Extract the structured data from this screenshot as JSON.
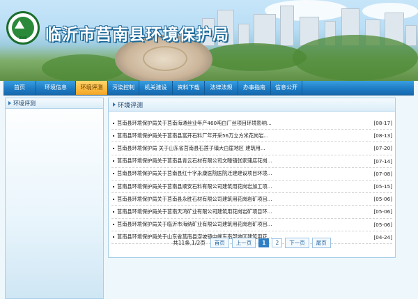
{
  "site": {
    "title": "临沂市莒南县环境保护局",
    "logo_text": "ZHB"
  },
  "nav": {
    "items": [
      {
        "label": "首页",
        "active": false
      },
      {
        "label": "环境信息",
        "active": false
      },
      {
        "label": "环境评测",
        "active": true
      },
      {
        "label": "污染控制",
        "active": false
      },
      {
        "label": "机关建设",
        "active": false
      },
      {
        "label": "资料下载",
        "active": false
      },
      {
        "label": "法律法规",
        "active": false
      },
      {
        "label": "办事指南",
        "active": false
      },
      {
        "label": "信息公开",
        "active": false
      }
    ]
  },
  "sidebar": {
    "heading": "环境评测"
  },
  "main": {
    "heading": "环境评测",
    "articles": [
      {
        "title": "莒南县环境保护局关于莒南海通丝业年产460吨白厂丝项目环境影响...",
        "date": "[08-17]"
      },
      {
        "title": "莒南县环境保护局关于莒南县富开石料厂年开采56万立方米花岗岩...",
        "date": "[08-13]"
      },
      {
        "title": "莒南县环境保护局 关于山东省莒南县石莲子镇大白崖地区 建筑用...",
        "date": "[07-20]"
      },
      {
        "title": "莒南县环境保护局关于莒南县青云石材有限公司文疃镇张家蒲店花岗...",
        "date": "[07-14]"
      },
      {
        "title": "莒南县环境保护局关于莒南县红十字永康医院医院迁建建设项目环境...",
        "date": "[07-08]"
      },
      {
        "title": "莒南县环境保护局关于莒南县顺安石料有限公司建筑用花岗岩加工项...",
        "date": "[05-15]"
      },
      {
        "title": "莒南县环境保护局关于莒南县永胜石材有限公司建筑用花岗岩矿项目...",
        "date": "[05-06]"
      },
      {
        "title": "莒南县环境保护局关于莒南天鸿矿业有限公司建筑用花岗岩矿项目环...",
        "date": "[05-06]"
      },
      {
        "title": "莒南县环境保护局关于临沂市海纳矿业有限公司建筑用花岗岩矿项目...",
        "date": "[05-06]"
      },
      {
        "title": "莒南县环境保护局关于山东省莒南县涝坡镇中峰东南部地区建筑用花...",
        "date": "[04-24]"
      }
    ],
    "pager": {
      "info": "共11条,1/2页",
      "first": "首页",
      "prev": "上一页",
      "pages": [
        "1",
        "2"
      ],
      "current_page": "1",
      "next": "下一页",
      "last": "尾页"
    }
  }
}
